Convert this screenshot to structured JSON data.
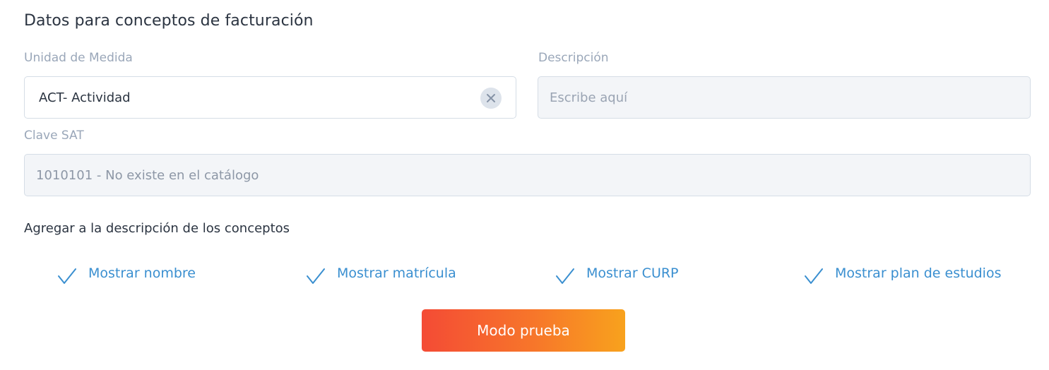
{
  "section_title": "Datos para conceptos de facturación",
  "unidad": {
    "label": "Unidad de Medida",
    "value": "ACT- Actividad"
  },
  "descripcion": {
    "label": "Descripción",
    "placeholder": "Escribe aquí"
  },
  "clave_sat": {
    "label": "Clave SAT",
    "value": "1010101 - No existe en el catálogo"
  },
  "agregar": {
    "heading": "Agregar a la descripción de los conceptos",
    "options": [
      {
        "label": "Mostrar nombre",
        "checked": true
      },
      {
        "label": "Mostrar matrícula",
        "checked": true
      },
      {
        "label": "Mostrar CURP",
        "checked": true
      },
      {
        "label": "Mostrar plan de estudios",
        "checked": true
      }
    ]
  },
  "action_button": "Modo prueba",
  "colors": {
    "accent_link": "#3a8fd0",
    "button_gradient_start": "#f44b35",
    "button_gradient_end": "#f8a21d"
  }
}
